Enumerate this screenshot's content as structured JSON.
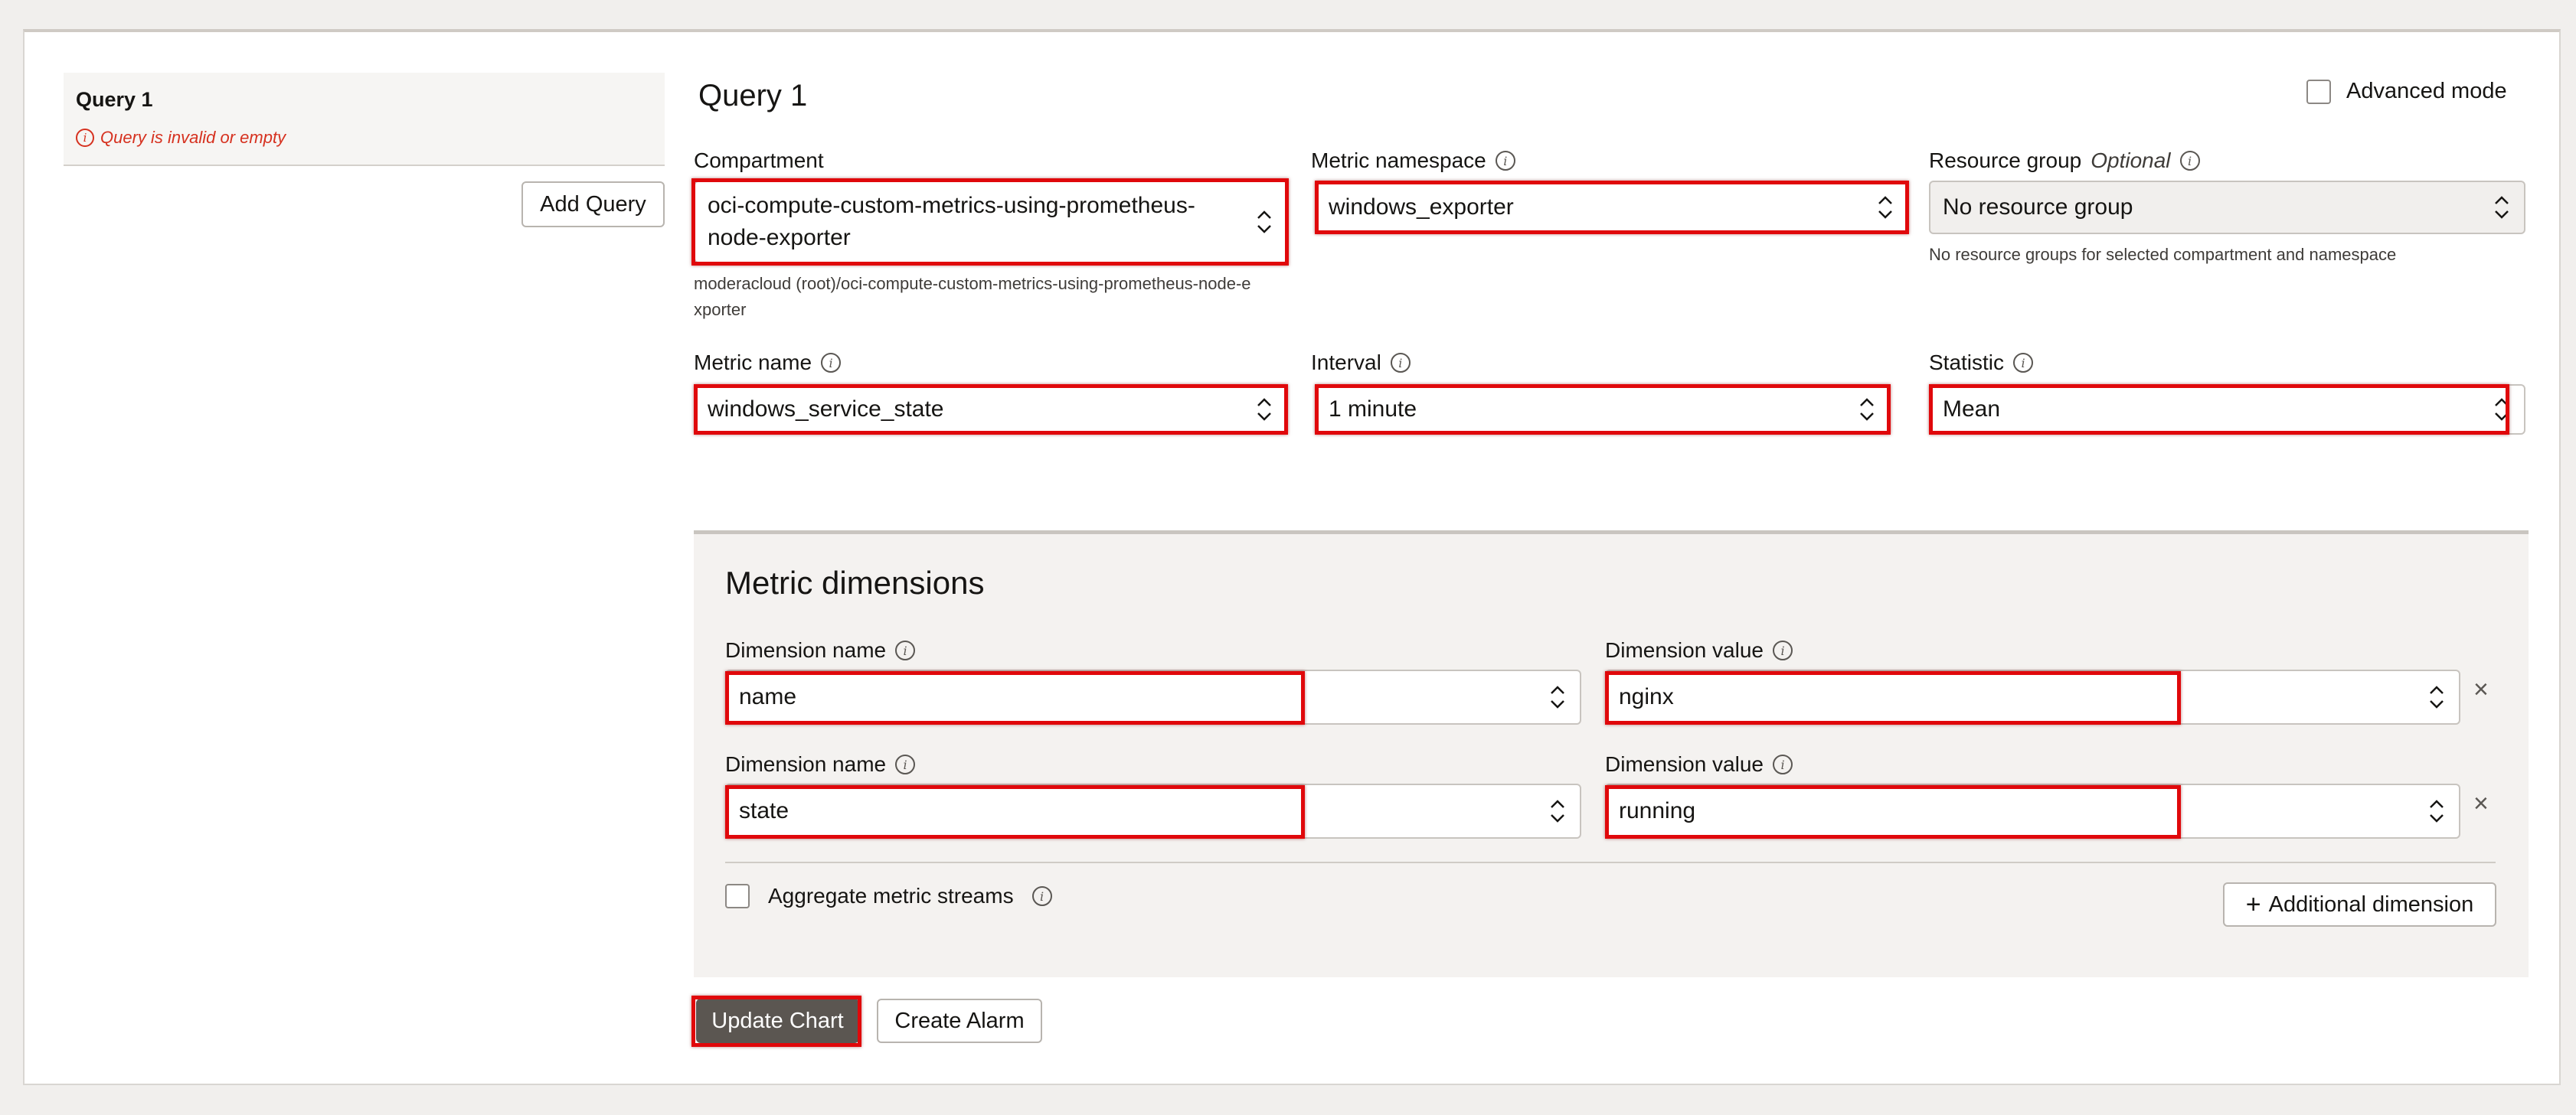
{
  "query_tab": {
    "title": "Query 1",
    "error": "Query is invalid or empty",
    "add_query": "Add Query"
  },
  "header": {
    "title": "Query 1",
    "advanced_mode": "Advanced mode"
  },
  "fields": {
    "compartment": {
      "label": "Compartment",
      "value_line1": "oci-compute-custom-metrics-using-prometheus-",
      "value_line2": "node-exporter",
      "helper_line1": "moderacloud (root)/oci-compute-custom-metrics-using-prometheus-node-e",
      "helper_line2": "xporter"
    },
    "metric_namespace": {
      "label": "Metric namespace",
      "value": "windows_exporter"
    },
    "resource_group": {
      "label": "Resource group",
      "optional": "Optional",
      "value": "No resource group",
      "helper": "No resource groups for selected compartment and namespace"
    },
    "metric_name": {
      "label": "Metric name",
      "value": "windows_service_state"
    },
    "interval": {
      "label": "Interval",
      "value": "1 minute"
    },
    "statistic": {
      "label": "Statistic",
      "value": "Mean"
    }
  },
  "dimensions": {
    "title": "Metric dimensions",
    "rows": [
      {
        "name_label": "Dimension name",
        "name_value": "name",
        "value_label": "Dimension value",
        "value_value": "nginx"
      },
      {
        "name_label": "Dimension name",
        "name_value": "state",
        "value_label": "Dimension value",
        "value_value": "running"
      }
    ],
    "aggregate_label": "Aggregate metric streams",
    "additional_dimension": "Additional dimension",
    "additional_dimension_icon": "+"
  },
  "actions": {
    "update_chart": "Update Chart",
    "create_alarm": "Create Alarm"
  },
  "icons": {
    "info": "i",
    "remove": "×"
  },
  "colors": {
    "highlight": "#e0080b",
    "error": "#d6311f",
    "primary_button": "#5b5651"
  }
}
